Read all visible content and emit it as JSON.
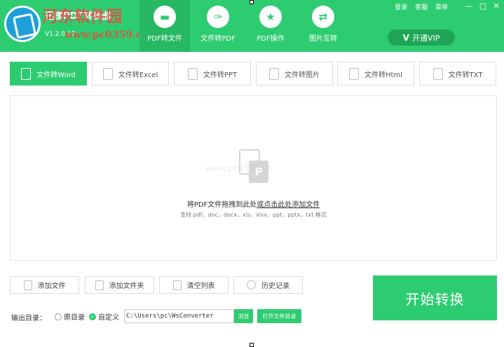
{
  "app": {
    "name": "迅捷PDF转换器",
    "version": "V1.2.0.17",
    "watermark_site": "河东软件园",
    "watermark_url": "www.pc0359.cn"
  },
  "nav": {
    "tabs": [
      {
        "label": "PDF转文件",
        "icon": "folder-icon",
        "glyph": "▬"
      },
      {
        "label": "文件转PDF",
        "icon": "pdf-icon",
        "glyph": "✑"
      },
      {
        "label": "PDF操作",
        "icon": "star-icon",
        "glyph": "★"
      },
      {
        "label": "图片互转",
        "icon": "swap-icon",
        "glyph": "⇄"
      }
    ]
  },
  "topbar": {
    "login": "登录",
    "support": "客服",
    "menu": "菜单",
    "minimize": "—",
    "maximize": "□",
    "close": "✕"
  },
  "vip": {
    "label": "开通VIP",
    "icon_glyph": "V"
  },
  "sub_tabs": [
    {
      "label": "文件转Word"
    },
    {
      "label": "文件转Excel"
    },
    {
      "label": "文件转PPT"
    },
    {
      "label": "文件转图片"
    },
    {
      "label": "文件转Html"
    },
    {
      "label": "文件转TXT"
    }
  ],
  "drop_zone": {
    "main_prefix": "将PDF文件拖拽到此处",
    "main_link": "或点击此处添加文件",
    "supported": "支持 pdf，doc，docx，xls，xlsx，ppt，pptx，txt 格式",
    "watermark": "www.pc0359.cn",
    "icon_letter": "P"
  },
  "actions": {
    "add_file": "添加文件",
    "add_folder": "添加文件夹",
    "clear_list": "清空列表",
    "history": "历史记录"
  },
  "start": {
    "label": "开始转换"
  },
  "output": {
    "label": "输出目录：",
    "option_original": "原目录",
    "option_custom": "自定义",
    "selected": "自定义",
    "path": "C:\\Users\\pc\\WsConverter",
    "browse": "浏览",
    "open_dir": "打开文件目录"
  },
  "colors": {
    "accent": "#2ecc71",
    "accent_dark": "#27b863"
  }
}
